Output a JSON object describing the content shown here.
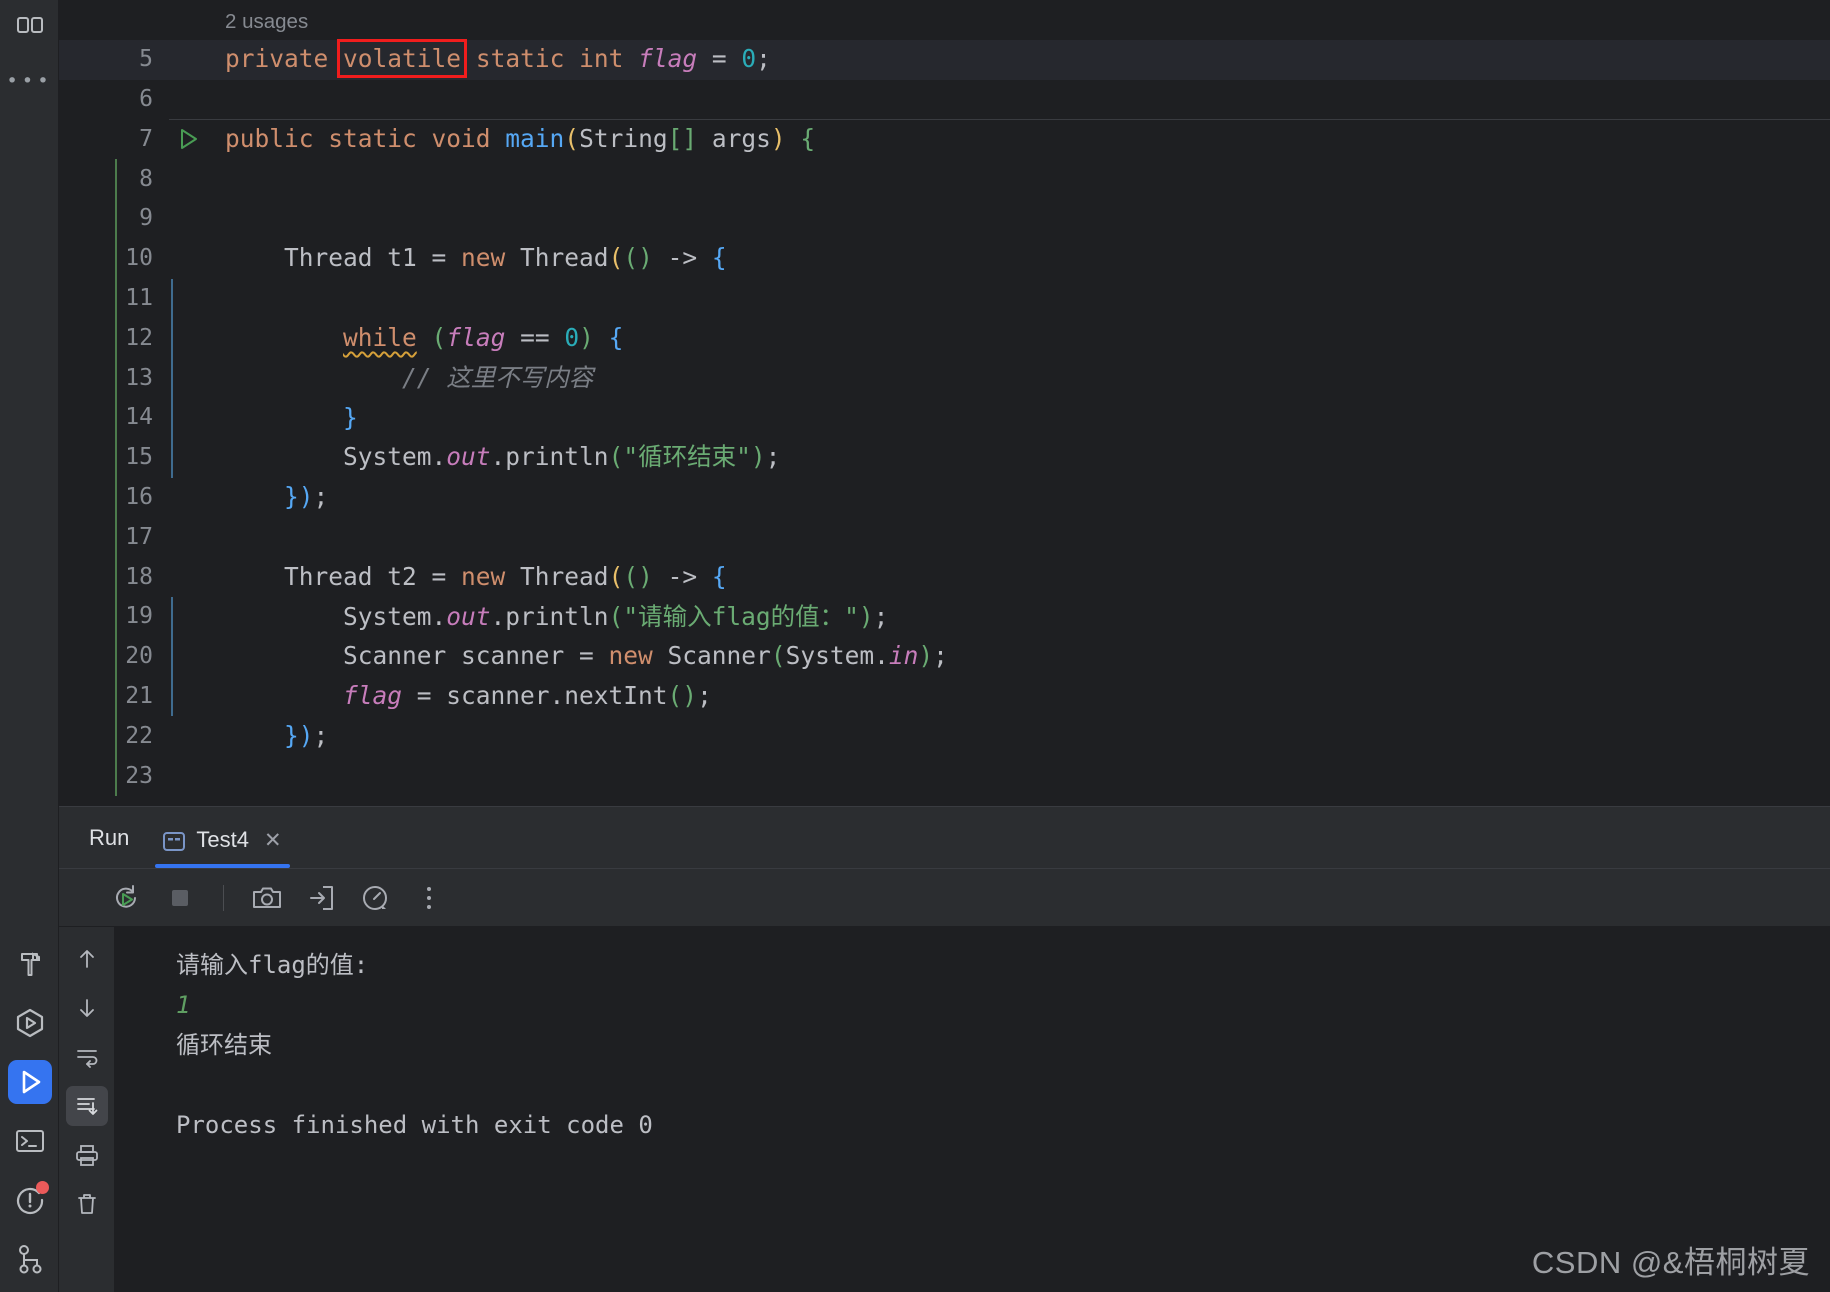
{
  "window": {
    "theme_bg": "#1e1f22",
    "accent": "#3574f0",
    "highlight_box_color": "#f01d1d"
  },
  "rail": {
    "top_icon": "apps-grid-icon",
    "more_label": "•••",
    "items": [
      {
        "name": "build-icon",
        "label": "Build",
        "active": false
      },
      {
        "name": "services-icon",
        "label": "Services",
        "active": false
      },
      {
        "name": "run-icon",
        "label": "Run",
        "active": true
      },
      {
        "name": "terminal-icon",
        "label": "Terminal",
        "active": false
      },
      {
        "name": "problems-icon",
        "label": "Problems",
        "active": false,
        "badge": true
      },
      {
        "name": "git-branch-icon",
        "label": "Version Control",
        "active": false
      }
    ]
  },
  "editor": {
    "usages_hint": "2 usages",
    "highlighted_token": "volatile",
    "lines": [
      {
        "no": "5",
        "highlighted": true
      },
      {
        "no": "6",
        "highlighted": false
      },
      {
        "no": "7",
        "highlighted": false
      },
      {
        "no": "8",
        "highlighted": false
      },
      {
        "no": "9",
        "highlighted": false
      },
      {
        "no": "10",
        "highlighted": false
      },
      {
        "no": "11",
        "highlighted": false
      },
      {
        "no": "12",
        "highlighted": false
      },
      {
        "no": "13",
        "highlighted": false
      },
      {
        "no": "14",
        "highlighted": false
      },
      {
        "no": "15",
        "highlighted": false
      },
      {
        "no": "16",
        "highlighted": false
      },
      {
        "no": "17",
        "highlighted": false
      },
      {
        "no": "18",
        "highlighted": false
      },
      {
        "no": "19",
        "highlighted": false
      },
      {
        "no": "20",
        "highlighted": false
      },
      {
        "no": "21",
        "highlighted": false
      },
      {
        "no": "22",
        "highlighted": false
      },
      {
        "no": "23",
        "highlighted": false
      }
    ],
    "code_text": {
      "l5_private": "private",
      "l5_volatile": "volatile",
      "l5_rest": "static int",
      "l5_flag": "flag",
      "l5_eq": "=",
      "l5_zero": "0",
      "l5_semi": ";",
      "l7_public": "public static void",
      "l7_main": "main",
      "l7_paren_open": "(",
      "l7_string_type": "String",
      "l7_brackets": "[]",
      "l7_args": " args",
      "l7_paren_close": ")",
      "l7_brace": "{",
      "l10_thread": "Thread t1 = ",
      "l10_new": "new",
      "l10_ctor": " Thread",
      "l10_p1": "(",
      "l10_p2": "()",
      "l10_arrow": " -> ",
      "l10_brace": "{",
      "l12_while": "while",
      "l12_p": "(",
      "l12_flag": "flag",
      "l12_op": " == ",
      "l12_zero": "0",
      "l12_pc": ")",
      "l12_brace": "{",
      "l13_comment": "// 这里不写内容",
      "l14_close": "}",
      "l15_system": "System.",
      "l15_out": "out",
      "l15_println": ".println",
      "l15_p": "(",
      "l15_str": "\"循环结束\"",
      "l15_pc": ")",
      "l15_semi": ";",
      "l16_close": "})",
      "l16_semi": ";",
      "l18_thread": "Thread t2 = ",
      "l18_new": "new",
      "l18_ctor": " Thread",
      "l19_str": "\"请输入flag的值：\"",
      "l20_scanner": "Scanner scanner = ",
      "l20_new": "new",
      "l20_ctor": " Scanner",
      "l20_sys": "System.",
      "l20_in": "in",
      "l21_flag": "flag",
      "l21_rest": " = scanner.nextInt",
      "l22_close": "})",
      "l22_semi": ";"
    }
  },
  "run_panel": {
    "title": "Run",
    "tab": {
      "label": "Test4",
      "icon": "console-tab-icon",
      "close_label": "✕",
      "selected": true
    },
    "toolbar": [
      {
        "name": "rerun-icon",
        "label": "Rerun"
      },
      {
        "name": "stop-icon",
        "label": "Stop"
      },
      {
        "name": "camera-icon",
        "label": "Screenshot"
      },
      {
        "name": "import-arrow-icon",
        "label": "Dump"
      },
      {
        "name": "profiler-gauge-icon",
        "label": "Profiler"
      },
      {
        "name": "more-vertical-icon",
        "label": "More"
      }
    ],
    "console_rail": [
      {
        "name": "arrow-up-icon",
        "label": "Up",
        "active": false
      },
      {
        "name": "arrow-down-icon",
        "label": "Down",
        "active": false
      },
      {
        "name": "soft-wrap-icon",
        "label": "Soft-Wrap",
        "active": false
      },
      {
        "name": "scroll-to-end-icon",
        "label": "Scroll to End",
        "active": true
      },
      {
        "name": "print-icon",
        "label": "Print",
        "active": false
      },
      {
        "name": "trash-icon",
        "label": "Clear All",
        "active": false
      }
    ],
    "console_output": {
      "prompt": "请输入flag的值:",
      "user_input": "1",
      "result": "循环结束",
      "exit_line": "Process finished with exit code 0"
    }
  },
  "watermark": "CSDN @&梧桐树夏"
}
